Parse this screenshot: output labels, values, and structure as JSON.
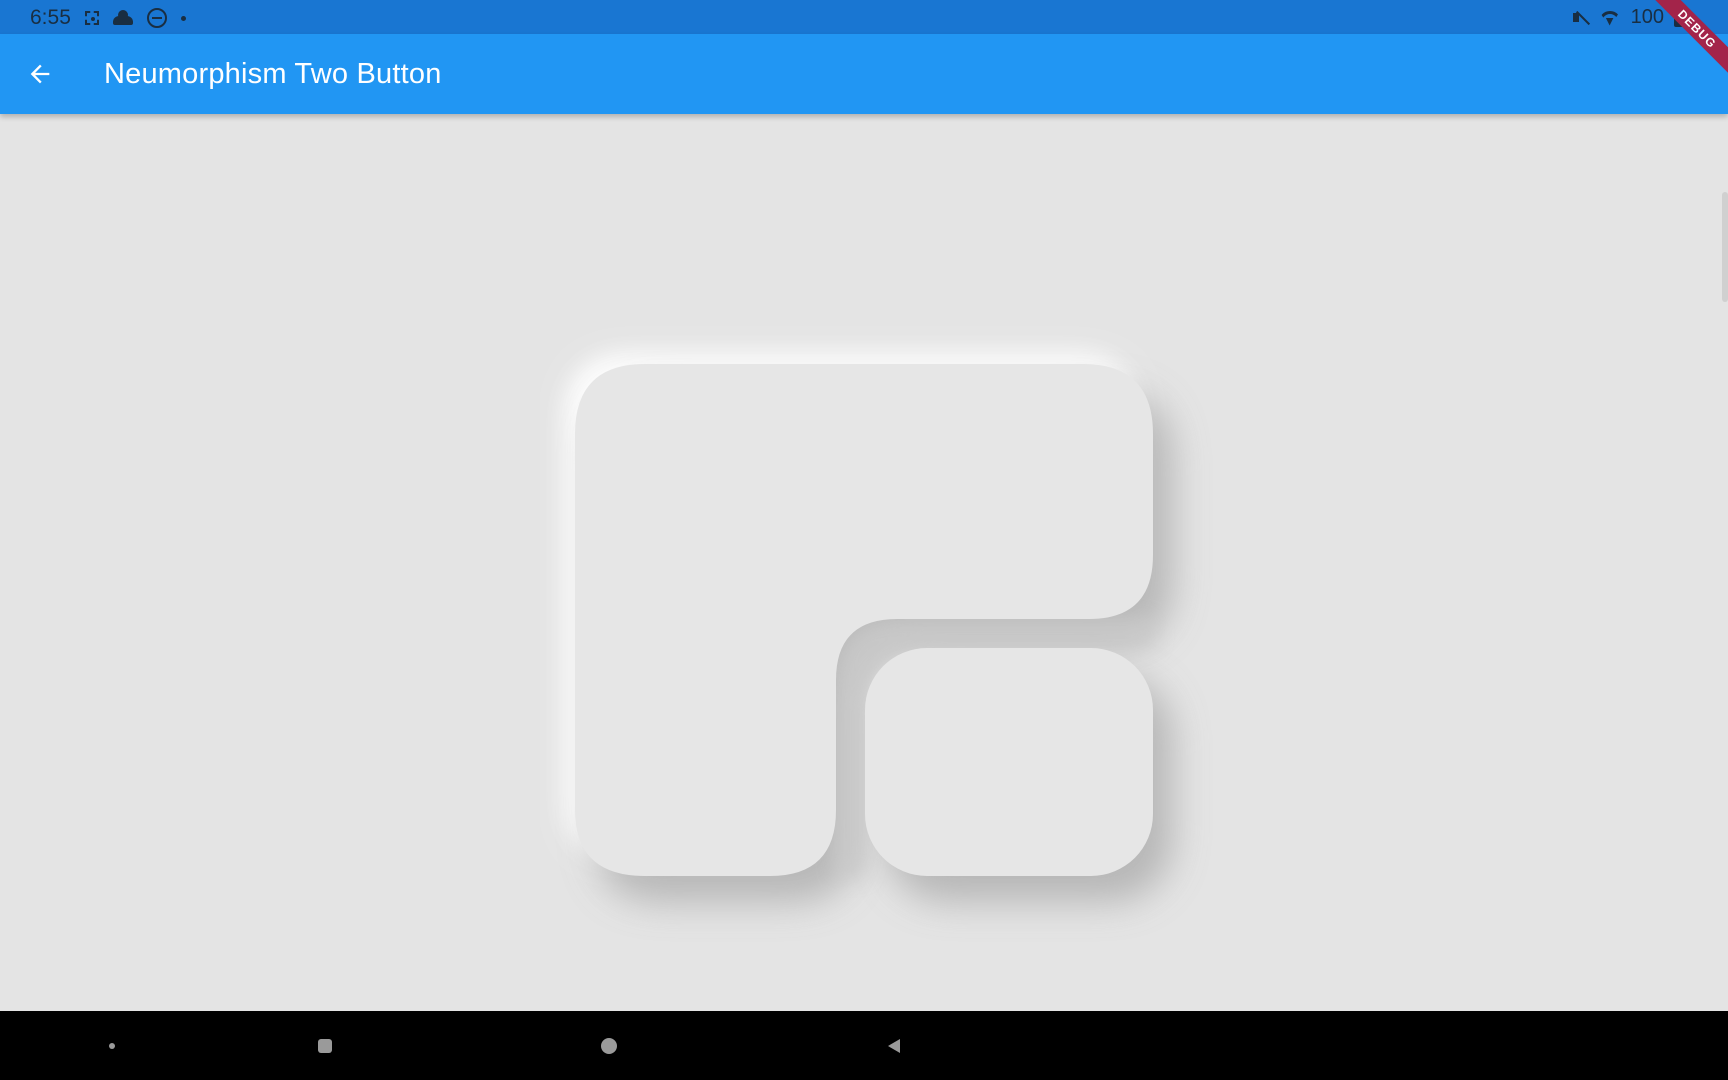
{
  "status_bar": {
    "time": "6:55",
    "battery": "100",
    "icons": [
      "screenshot-icon",
      "cloud-icon",
      "do-not-disturb-icon",
      "notification-dot-icon",
      "mute-icon",
      "wifi-icon",
      "battery-icon"
    ]
  },
  "app_bar": {
    "title": "Neumorphism Two Button",
    "back_icon": "arrow-back-icon",
    "color": "#2196f3"
  },
  "debug_banner": {
    "label": "DEBUG",
    "color": "#a3244a"
  },
  "content": {
    "background": "#e4e4e4",
    "buttons": [
      {
        "name": "large-neumorphic-button",
        "shape": "L-shaped"
      },
      {
        "name": "small-neumorphic-button",
        "shape": "rounded-square"
      }
    ]
  },
  "nav_bar": {
    "buttons": [
      "assistant-dot-icon",
      "recents-icon",
      "home-icon",
      "back-triangle-icon"
    ]
  }
}
